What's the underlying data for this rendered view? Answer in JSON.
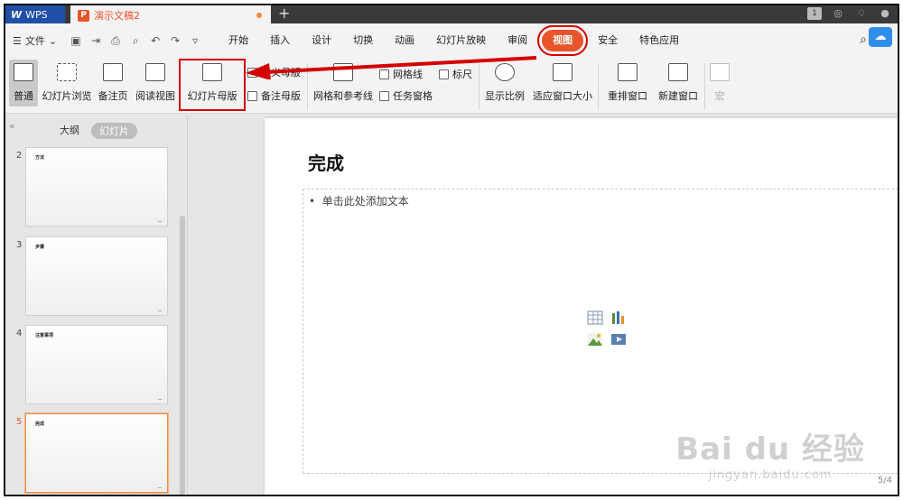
{
  "titlebar": {
    "app_name": "WPS",
    "doc_name": "演示文稿2",
    "doc_icon": "P",
    "new_tab": "+"
  },
  "menubar": {
    "file": "文件",
    "tabs": [
      {
        "label": "开始"
      },
      {
        "label": "插入"
      },
      {
        "label": "设计"
      },
      {
        "label": "切换"
      },
      {
        "label": "动画"
      },
      {
        "label": "幻灯片放映"
      },
      {
        "label": "审阅"
      },
      {
        "label": "视图",
        "active": true
      },
      {
        "label": "安全"
      },
      {
        "label": "特色应用"
      }
    ]
  },
  "ribbon": {
    "normal": "普通",
    "slide_sorter": "幻灯片浏览",
    "notes_page": "备注页",
    "reading_view": "阅读视图",
    "slide_master": "幻灯片母版",
    "handout_master": "讲义母版",
    "notes_master": "备注母版",
    "grid_guides": "网格和参考线",
    "gridlines": "网格线",
    "ruler": "标尺",
    "task_pane": "任务窗格",
    "zoom": "显示比例",
    "fit_window": "适应窗口大小",
    "arrange": "重排窗口",
    "new_window": "新建窗口",
    "macro": "宏"
  },
  "leftpanel": {
    "outline_tab": "大纲",
    "slides_tab": "幻灯片",
    "thumbnails": [
      {
        "num": "2",
        "title": "方法"
      },
      {
        "num": "3",
        "title": "步骤"
      },
      {
        "num": "4",
        "title": "注意事项"
      },
      {
        "num": "5",
        "title": "完成",
        "current": true
      }
    ]
  },
  "slide": {
    "title": "完成",
    "placeholder": "单击此处添加文本",
    "page": "5/4"
  },
  "watermark": {
    "brand": "Bai du 经验",
    "url": "jingyan.baidu.com"
  },
  "colors": {
    "accent": "#e8552a",
    "annotation": "#d40000",
    "wps_blue": "#1f4fa6"
  }
}
